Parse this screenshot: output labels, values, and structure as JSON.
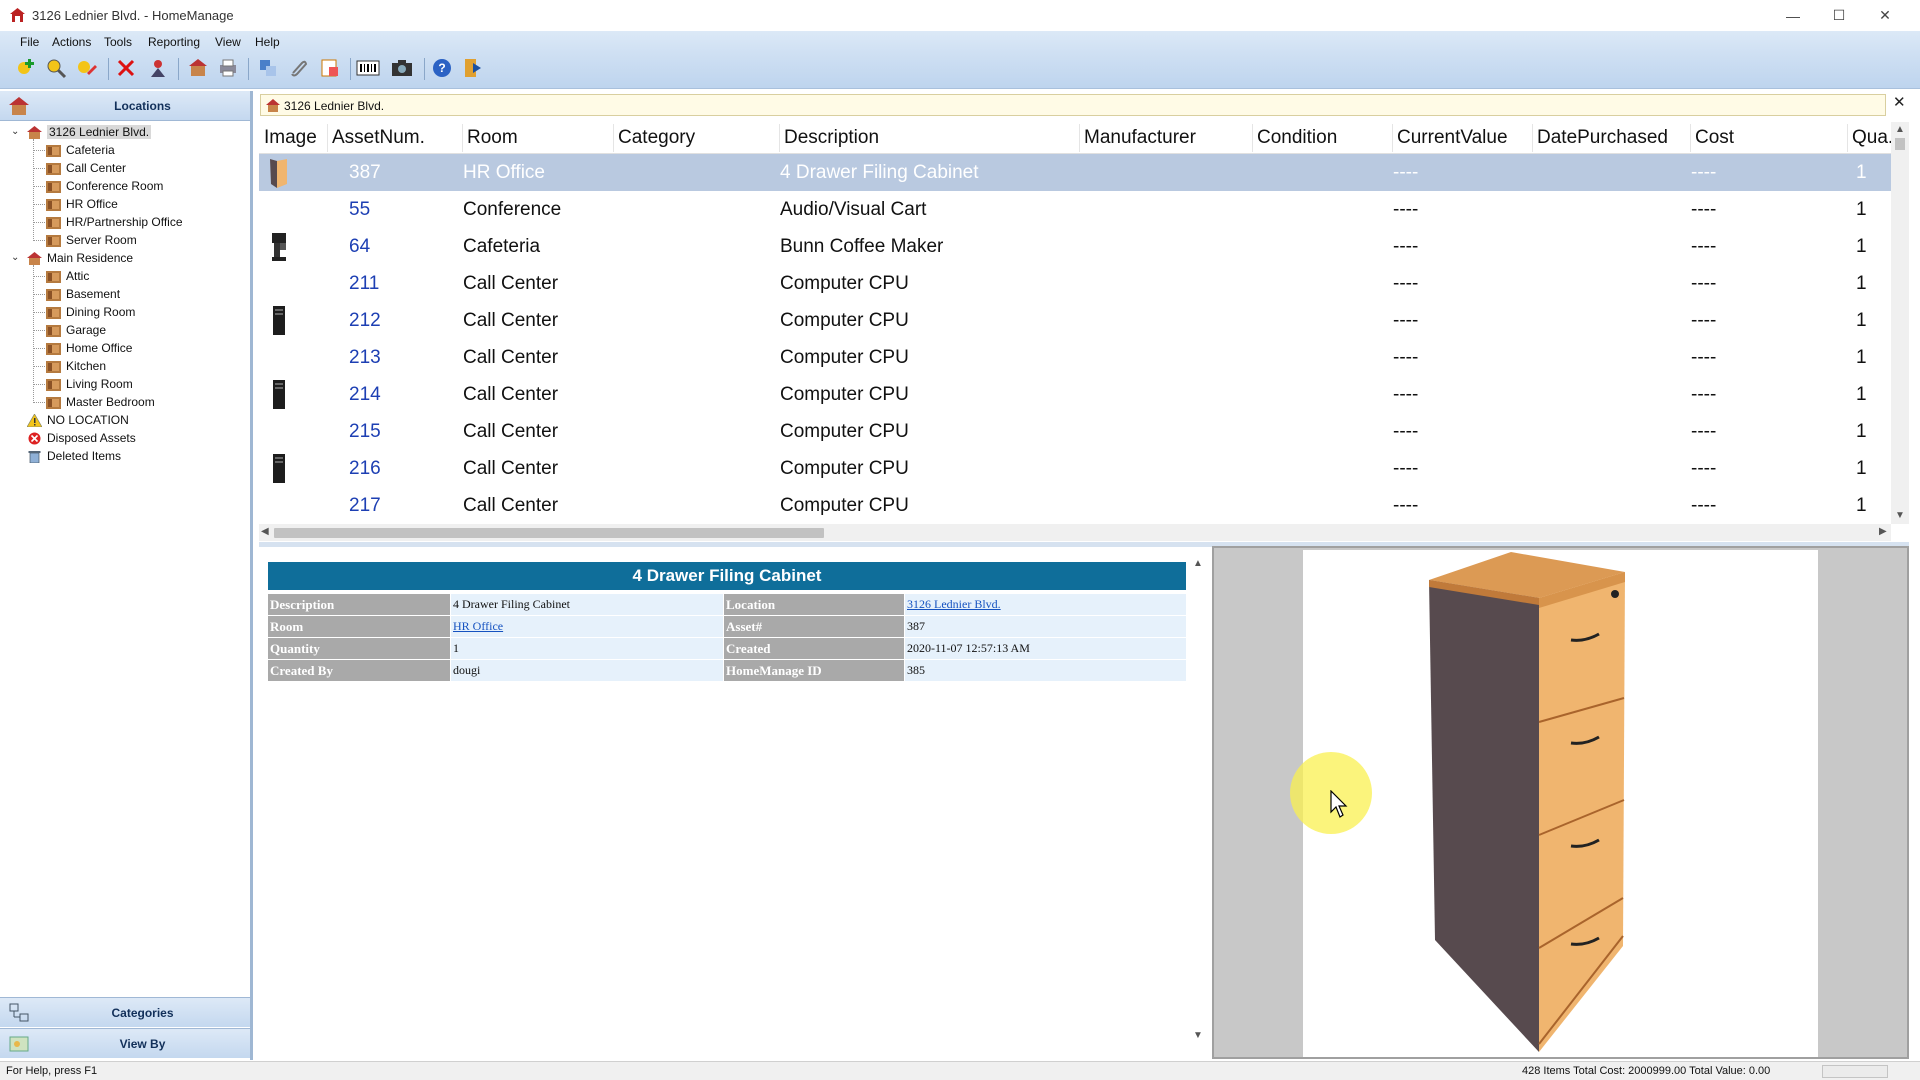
{
  "window": {
    "title": "3126 Lednier Blvd. - HomeManage",
    "minimize": "—",
    "maximize": "☐",
    "close": "✕"
  },
  "menu": [
    "File",
    "Actions",
    "Tools",
    "Reporting",
    "View",
    "Help"
  ],
  "toolbar": {
    "icons": [
      "add-item-icon",
      "find-icon",
      "edit-icon",
      "delete-icon",
      "user-icon",
      "locations-icon",
      "print-icon",
      "move-icon",
      "attach-icon",
      "barcode-icon",
      "camera-icon",
      "help-icon",
      "exit-icon"
    ]
  },
  "left_panel": {
    "header": "Locations",
    "tree": [
      {
        "label": "3126 Lednier Blvd.",
        "level": 0,
        "icon": "location-house-icon",
        "expanded": true,
        "selected": true
      },
      {
        "label": "Cafeteria",
        "level": 1,
        "icon": "room-icon"
      },
      {
        "label": "Call Center",
        "level": 1,
        "icon": "room-icon"
      },
      {
        "label": "Conference Room",
        "level": 1,
        "icon": "room-icon"
      },
      {
        "label": "HR Office",
        "level": 1,
        "icon": "room-icon"
      },
      {
        "label": "HR/Partnership Office",
        "level": 1,
        "icon": "room-icon"
      },
      {
        "label": "Server Room",
        "level": 1,
        "icon": "room-icon"
      },
      {
        "label": "Main Residence",
        "level": 0,
        "icon": "location-house-icon",
        "expanded": true
      },
      {
        "label": "Attic",
        "level": 1,
        "icon": "room-icon"
      },
      {
        "label": "Basement",
        "level": 1,
        "icon": "room-icon"
      },
      {
        "label": "Dining Room",
        "level": 1,
        "icon": "room-icon"
      },
      {
        "label": "Garage",
        "level": 1,
        "icon": "room-icon"
      },
      {
        "label": "Home Office",
        "level": 1,
        "icon": "room-icon"
      },
      {
        "label": "Kitchen",
        "level": 1,
        "icon": "room-icon"
      },
      {
        "label": "Living Room",
        "level": 1,
        "icon": "room-icon"
      },
      {
        "label": "Master Bedroom",
        "level": 1,
        "icon": "room-icon"
      },
      {
        "label": "NO LOCATION",
        "level": 0,
        "icon": "warning-icon"
      },
      {
        "label": "Disposed Assets",
        "level": 0,
        "icon": "disposed-icon"
      },
      {
        "label": "Deleted Items",
        "level": 0,
        "icon": "trash-icon"
      }
    ],
    "footer": [
      "Categories",
      "View By"
    ]
  },
  "path_bar": {
    "text": "3126 Lednier Blvd.",
    "close": "✕"
  },
  "grid": {
    "columns": [
      "Image",
      "AssetNum.",
      "Room",
      "Category",
      "Description",
      "Manufacturer",
      "Condition",
      "CurrentValue",
      "DatePurchased",
      "Cost",
      "Qua..."
    ],
    "rows": [
      {
        "image": "cabinet",
        "asset": "387",
        "room": "HR Office",
        "category": "",
        "description": "4 Drawer Filing Cabinet",
        "manufacturer": "",
        "condition": "",
        "value": "----",
        "date": "",
        "cost": "----",
        "qty": "1",
        "selected": true
      },
      {
        "image": "",
        "asset": "55",
        "room": "Conference",
        "category": "",
        "description": "Audio/Visual Cart",
        "manufacturer": "",
        "condition": "",
        "value": "----",
        "date": "",
        "cost": "----",
        "qty": "1"
      },
      {
        "image": "coffee",
        "asset": "64",
        "room": "Cafeteria",
        "category": "",
        "description": "Bunn Coffee Maker",
        "manufacturer": "",
        "condition": "",
        "value": "----",
        "date": "",
        "cost": "----",
        "qty": "1"
      },
      {
        "image": "",
        "asset": "211",
        "room": "Call Center",
        "category": "",
        "description": "Computer CPU",
        "manufacturer": "",
        "condition": "",
        "value": "----",
        "date": "",
        "cost": "----",
        "qty": "1"
      },
      {
        "image": "cpu",
        "asset": "212",
        "room": "Call Center",
        "category": "",
        "description": "Computer CPU",
        "manufacturer": "",
        "condition": "",
        "value": "----",
        "date": "",
        "cost": "----",
        "qty": "1"
      },
      {
        "image": "",
        "asset": "213",
        "room": "Call Center",
        "category": "",
        "description": "Computer CPU",
        "manufacturer": "",
        "condition": "",
        "value": "----",
        "date": "",
        "cost": "----",
        "qty": "1"
      },
      {
        "image": "cpu",
        "asset": "214",
        "room": "Call Center",
        "category": "",
        "description": "Computer CPU",
        "manufacturer": "",
        "condition": "",
        "value": "----",
        "date": "",
        "cost": "----",
        "qty": "1"
      },
      {
        "image": "",
        "asset": "215",
        "room": "Call Center",
        "category": "",
        "description": "Computer CPU",
        "manufacturer": "",
        "condition": "",
        "value": "----",
        "date": "",
        "cost": "----",
        "qty": "1"
      },
      {
        "image": "cpu",
        "asset": "216",
        "room": "Call Center",
        "category": "",
        "description": "Computer CPU",
        "manufacturer": "",
        "condition": "",
        "value": "----",
        "date": "",
        "cost": "----",
        "qty": "1"
      },
      {
        "image": "",
        "asset": "217",
        "room": "Call Center",
        "category": "",
        "description": "Computer CPU",
        "manufacturer": "",
        "condition": "",
        "value": "----",
        "date": "",
        "cost": "----",
        "qty": "1"
      }
    ]
  },
  "detail": {
    "title": "4 Drawer Filing Cabinet",
    "rows": [
      {
        "l1": "Description",
        "v1": "4 Drawer Filing Cabinet",
        "v1_link": false,
        "l2": "Location",
        "v2": "3126 Lednier Blvd.",
        "v2_link": true
      },
      {
        "l1": "Room",
        "v1": "HR Office",
        "v1_link": true,
        "l2": "Asset#",
        "v2": "387",
        "v2_link": false
      },
      {
        "l1": "Quantity",
        "v1": "1",
        "v1_link": false,
        "l2": "Created",
        "v2": "2020-11-07 12:57:13 AM",
        "v2_link": false
      },
      {
        "l1": "Created By",
        "v1": "dougi",
        "v1_link": false,
        "l2": "HomeManage ID",
        "v2": "385",
        "v2_link": false
      }
    ]
  },
  "status": {
    "help": "For Help, press F1",
    "summary": "428 Items  Total Cost: 2000999.00  Total Value: 0.00"
  },
  "colors": {
    "detail_title_bg": "#0f6e9a",
    "selected_row": "#b9c9e0",
    "asset_link": "#1d3fb3"
  }
}
